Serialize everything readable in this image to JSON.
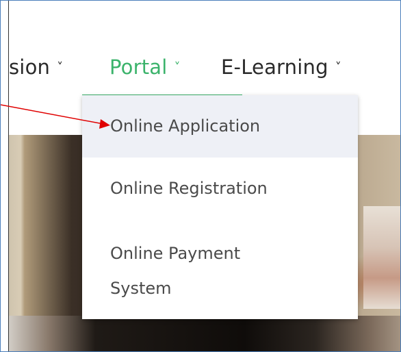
{
  "nav": {
    "items": [
      {
        "label": "sion",
        "chevron": "˅"
      },
      {
        "label": "Portal",
        "chevron": "˅",
        "active": true
      },
      {
        "label": "E-Learning",
        "chevron": "˅"
      }
    ],
    "active_color": "#3bb36b"
  },
  "dropdown": {
    "items": [
      {
        "label": "Online Application",
        "highlighted": true
      },
      {
        "label": "Online Registration"
      },
      {
        "label_line1": "Online Payment",
        "label_line2": "System"
      }
    ]
  },
  "annotation": {
    "arrow_color": "#e00000"
  }
}
